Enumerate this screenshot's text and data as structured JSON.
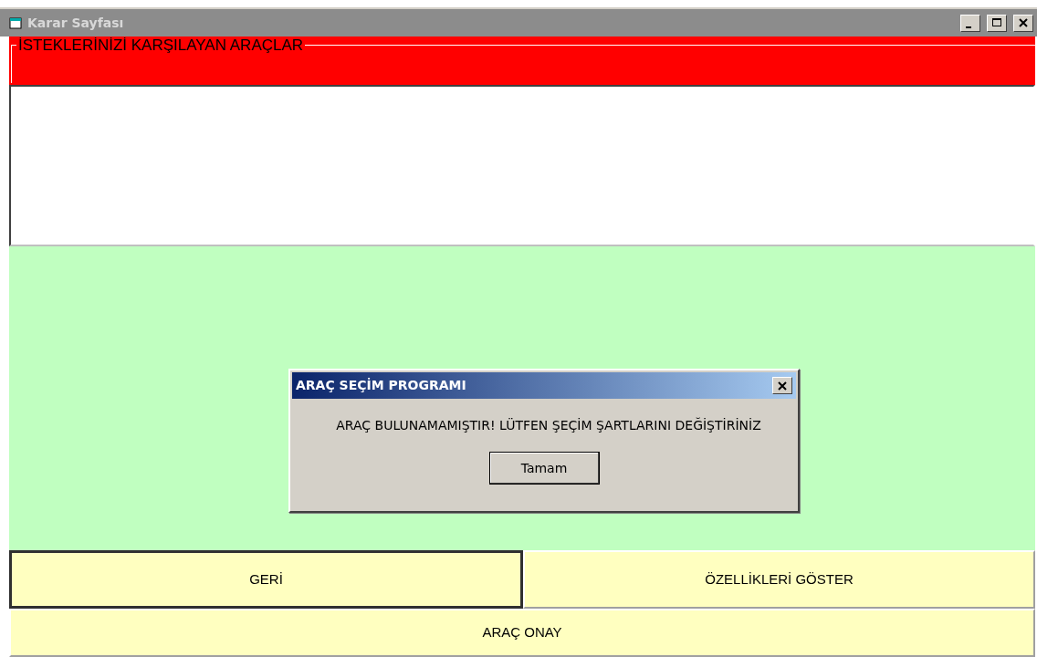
{
  "window": {
    "title": "Karar Sayfası"
  },
  "frame": {
    "caption": "İSTEKLERİNİZİ KARŞILAYAN ARAÇLAR"
  },
  "buttons": [
    {
      "label": "GERİ",
      "focused": true
    },
    {
      "label": "ÖZELLİKLERİ GÖSTER",
      "focused": false
    },
    {
      "label": "ARAÇ ONAY",
      "focused": false
    }
  ],
  "dialog": {
    "title": "ARAÇ SEÇİM PROGRAMI",
    "message": "ARAÇ BULUNAMAMIŞTIR! LÜTFEN ŞEÇİM ŞARTLARINI DEĞİŞTİRİNİZ",
    "button": "Tamam"
  }
}
